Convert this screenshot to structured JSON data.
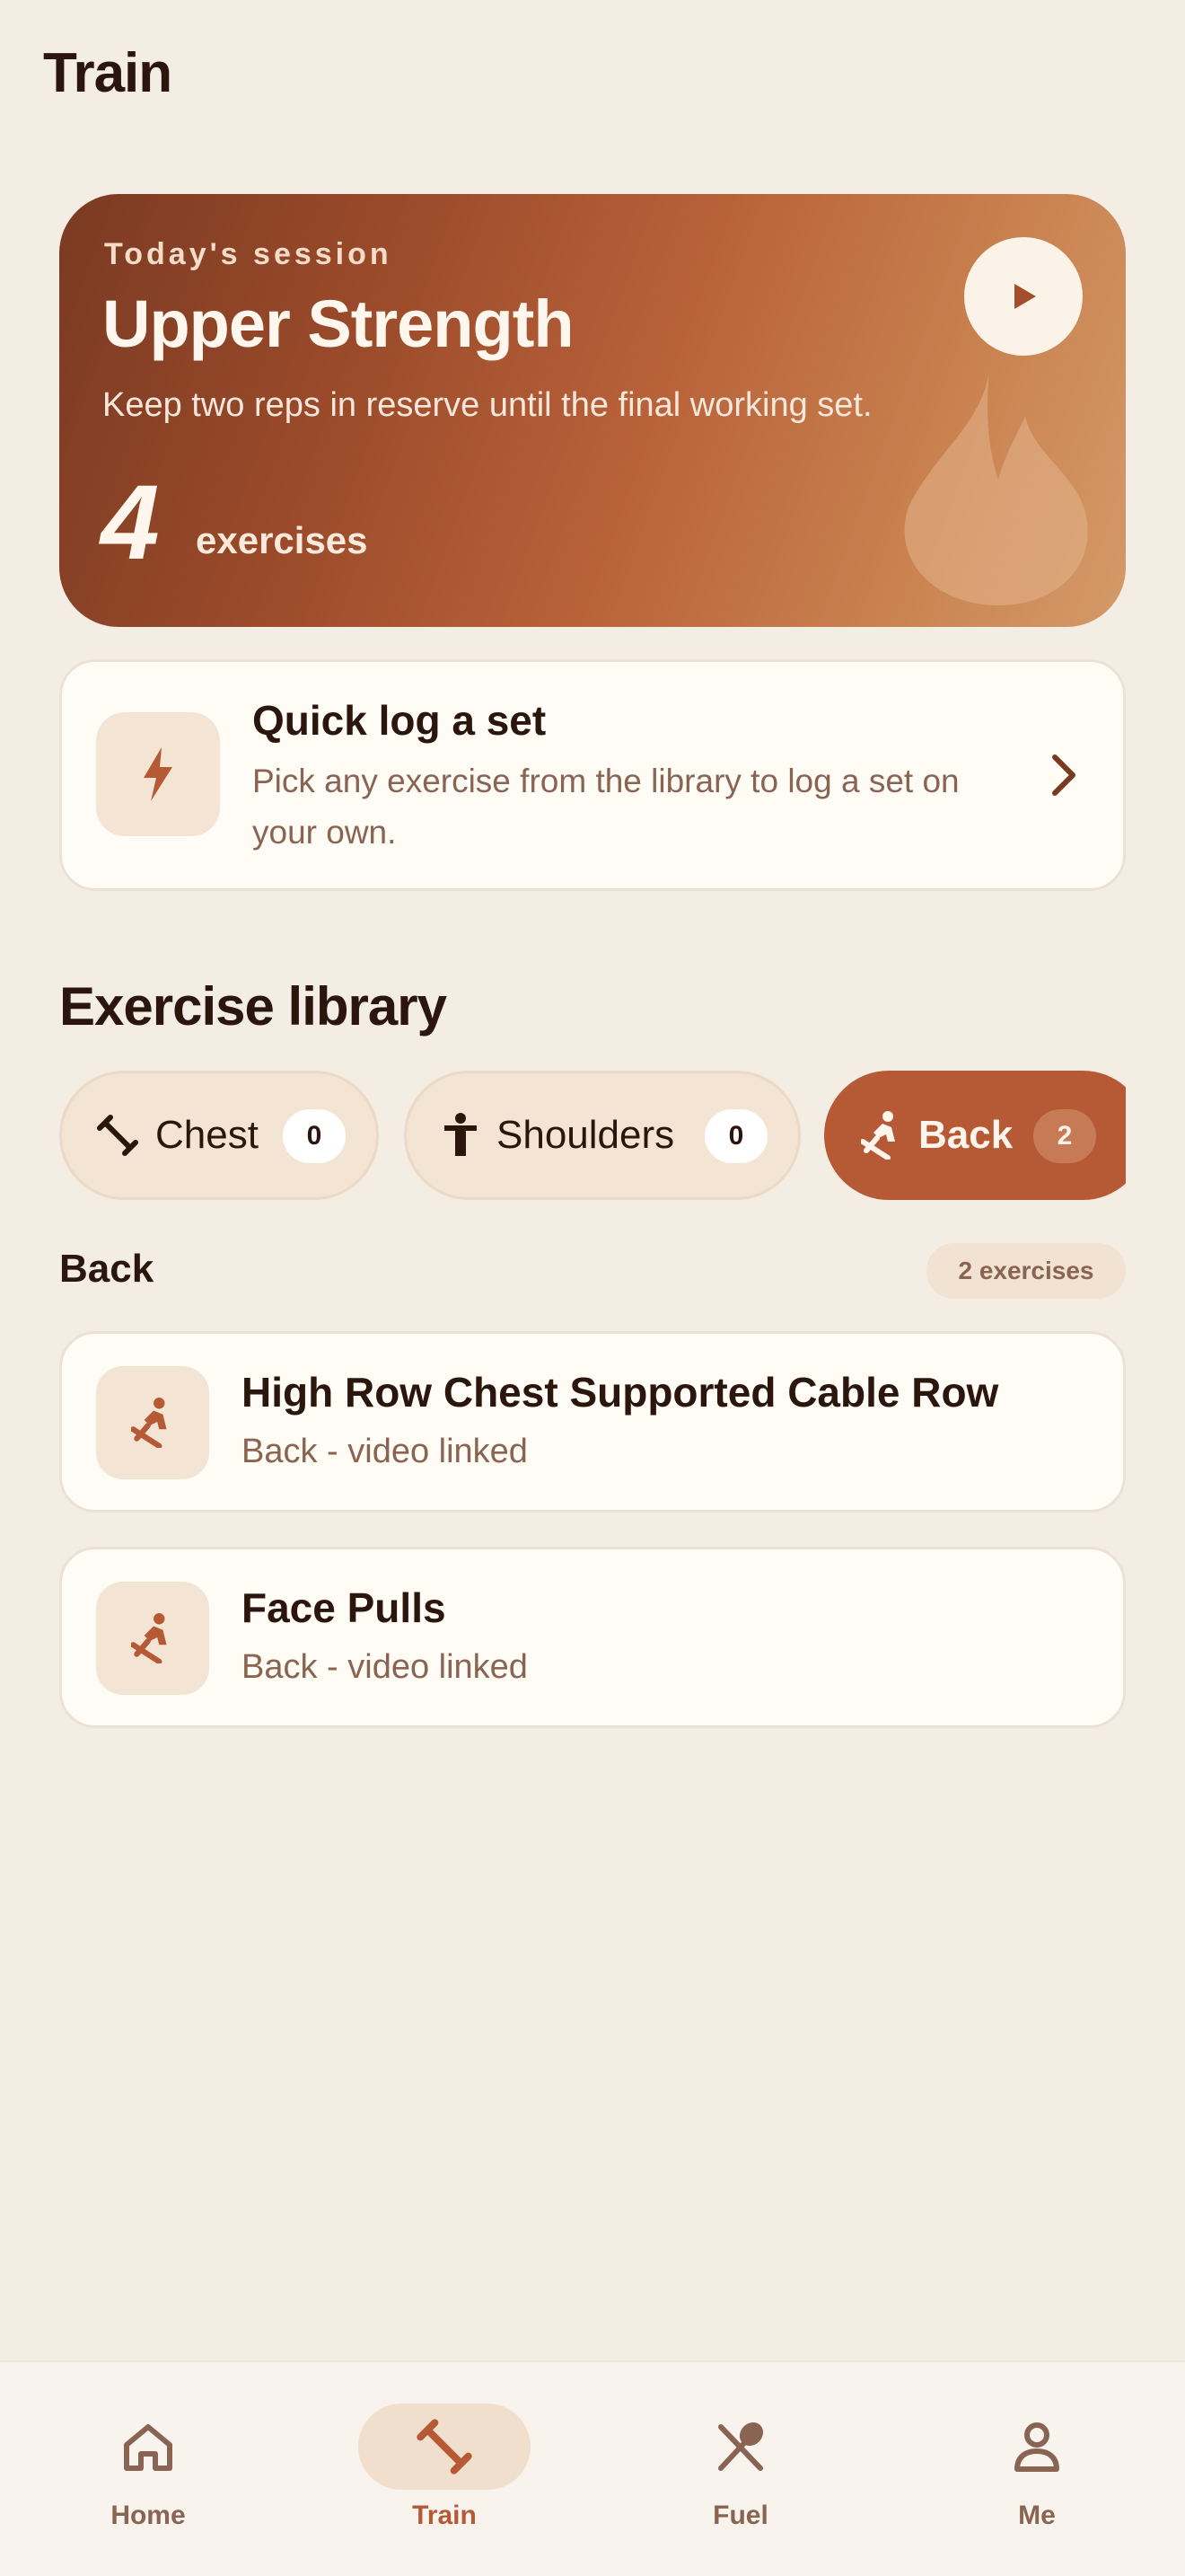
{
  "header": {
    "title": "Train"
  },
  "hero": {
    "eyebrow": "Today's session",
    "title": "Upper Strength",
    "subtitle": "Keep two reps in reserve until the final working set.",
    "count": "4",
    "count_label": "exercises",
    "play_icon": "play-icon",
    "decor_icon": "flame-icon"
  },
  "quick_log": {
    "title": "Quick log a set",
    "description": "Pick any exercise from the library to log a set on your own.",
    "icon": "bolt-icon"
  },
  "library": {
    "title": "Exercise library",
    "chips": [
      {
        "label": "Chest",
        "count": "0",
        "icon": "dumbbell-icon",
        "active": false
      },
      {
        "label": "Shoulders",
        "count": "0",
        "icon": "person-arms-icon",
        "active": false
      },
      {
        "label": "Back",
        "count": "2",
        "icon": "rowing-icon",
        "active": true
      }
    ],
    "group": {
      "title": "Back",
      "badge": "2 exercises"
    },
    "exercises": [
      {
        "name": "High Row Chest Supported Cable Row",
        "meta": "Back - video linked"
      },
      {
        "name": "Face Pulls",
        "meta": "Back - video linked"
      }
    ]
  },
  "nav": [
    {
      "label": "Home",
      "icon": "home-icon",
      "active": false
    },
    {
      "label": "Train",
      "icon": "dumbbell-icon",
      "active": true
    },
    {
      "label": "Fuel",
      "icon": "utensils-icon",
      "active": false
    },
    {
      "label": "Me",
      "icon": "person-icon",
      "active": false
    }
  ],
  "colors": {
    "background": "#f3ede4",
    "accent": "#b65a36",
    "text": "#2b160d",
    "muted": "#8a6452"
  }
}
